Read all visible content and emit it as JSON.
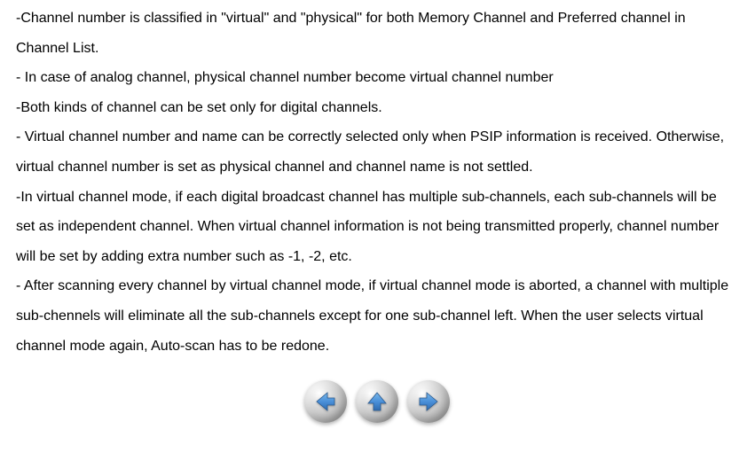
{
  "document": {
    "p1": "-Channel number is classified in \"virtual\" and \"physical\" for both Memory Channel and Preferred channel in Channel List.",
    "p2": "- In case of analog channel, physical channel number become virtual channel number",
    "p3": "-Both kinds of channel can be set only for digital channels.",
    "p4": "- Virtual channel number and name can be correctly selected only when PSIP information is received.   Otherwise, virtual channel number is set as physical channel and channel name is not settled.",
    "p5": "-In virtual channel mode, if each digital broadcast channel has multiple sub-channels, each sub-channels will be set as independent channel.   When virtual channel information is not being transmitted properly, channel number will be set by adding extra number such as -1, -2, etc.",
    "p6": "- After scanning every channel by virtual channel mode, if virtual channel mode is aborted, a channel with multiple sub-chennels will eliminate all the sub-channels except for one sub-channel left.   When the user selects virtual channel mode again, Auto-scan has to be redone."
  },
  "nav": {
    "back": "Back",
    "up": "Up",
    "forward": "Forward"
  }
}
